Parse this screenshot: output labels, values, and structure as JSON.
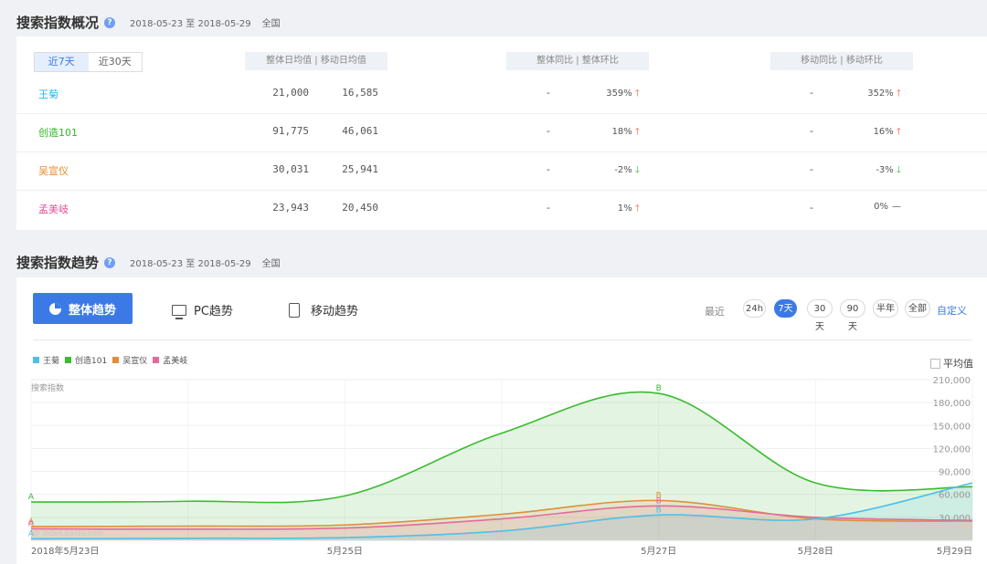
{
  "overview": {
    "title": "搜索指数概况",
    "date_range": "2018-05-23 至 2018-05-29",
    "region": "全国",
    "tabs": [
      "近7天",
      "近30天"
    ],
    "active_tab": "近7天",
    "col_avg": "整体日均值 | 移动日均值",
    "col_yoy_all": "整体同比 | 整体环比",
    "col_yoy_mobile": "移动同比 | 移动环比",
    "rows": [
      {
        "keyword": "王菊",
        "color": "#2cb7e8",
        "overall_avg": "21,000",
        "mobile_avg": "16,585",
        "overall_yoy": "-",
        "overall_mom": "359%",
        "overall_dir": "up",
        "mobile_yoy": "-",
        "mobile_mom": "352%",
        "mobile_dir": "up"
      },
      {
        "keyword": "创造101",
        "color": "#34b52a",
        "overall_avg": "91,775",
        "mobile_avg": "46,061",
        "overall_yoy": "-",
        "overall_mom": "18%",
        "overall_dir": "up",
        "mobile_yoy": "-",
        "mobile_mom": "16%",
        "mobile_dir": "up"
      },
      {
        "keyword": "吴宣仪",
        "color": "#e8892e",
        "overall_avg": "30,031",
        "mobile_avg": "25,941",
        "overall_yoy": "-",
        "overall_mom": "-2%",
        "overall_dir": "down",
        "mobile_yoy": "-",
        "mobile_mom": "-3%",
        "mobile_dir": "down"
      },
      {
        "keyword": "孟美岐",
        "color": "#e8519a",
        "overall_avg": "23,943",
        "mobile_avg": "20,450",
        "overall_yoy": "-",
        "overall_mom": "1%",
        "overall_dir": "up",
        "mobile_yoy": "-",
        "mobile_mom": "0%",
        "mobile_dir": "flat"
      }
    ]
  },
  "trend": {
    "title": "搜索指数趋势",
    "date_range": "2018-05-23 至 2018-05-29",
    "region": "全国",
    "views": [
      "整体趋势",
      "PC趋势",
      "移动趋势"
    ],
    "active_view": "整体趋势",
    "range_label": "最近",
    "ranges": [
      "24h",
      "7天",
      "30天",
      "90天",
      "半年",
      "全部"
    ],
    "active_range": "7天",
    "custom": "自定义",
    "average_label": "平均值",
    "watermark": "© index.baidu.com"
  },
  "chart_data": {
    "type": "area",
    "ylabel": "搜索指数",
    "x": [
      "2018-05-23",
      "2018-05-24",
      "2018-05-25",
      "2018-05-26",
      "2018-05-27",
      "2018-05-28",
      "2018-05-29"
    ],
    "x_tick_labels": [
      "2018年5月23日",
      "5月25日",
      "5月27日",
      "5月28日",
      "5月29日"
    ],
    "y_ticks": [
      "210,000",
      "180,000",
      "150,000",
      "120,000",
      "90,000",
      "60,000",
      "30,000"
    ],
    "ylim": [
      0,
      210000
    ],
    "grid": true,
    "legend_position": "top-left",
    "series": [
      {
        "name": "王菊",
        "color": "#4ec0e8",
        "values": [
          2000,
          2500,
          3500,
          12000,
          33000,
          28000,
          75000
        ]
      },
      {
        "name": "创造101",
        "color": "#3bbb2f",
        "values": [
          50000,
          51000,
          58000,
          140000,
          192000,
          75000,
          70000
        ]
      },
      {
        "name": "吴宣仪",
        "color": "#e08e3a",
        "values": [
          18000,
          18500,
          20000,
          34000,
          52000,
          28000,
          25000
        ]
      },
      {
        "name": "孟美岐",
        "color": "#e36a9b",
        "values": [
          15000,
          14500,
          16000,
          28000,
          45000,
          30000,
          26000
        ]
      }
    ],
    "annotations": [
      {
        "label": "A",
        "x": "2018-05-23"
      },
      {
        "label": "B",
        "x": "2018-05-27"
      }
    ]
  }
}
